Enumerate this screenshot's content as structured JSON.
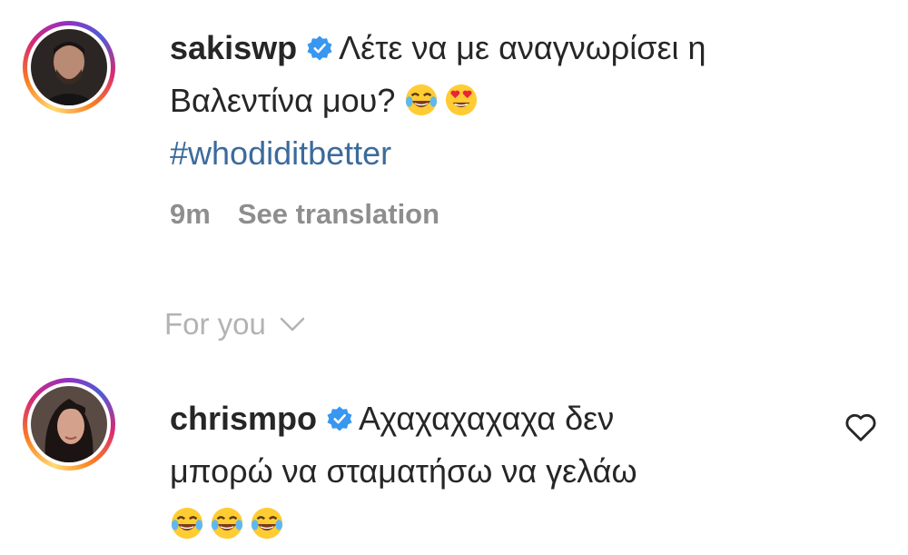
{
  "comments": [
    {
      "username": "sakiswp",
      "text_line1": "Λέτε να με αναγνωρίσει η",
      "text_line2": "Βαλεντίνα μου?",
      "hashtag": "#whodiditbetter",
      "time": "9m",
      "translate_label": "See translation",
      "emojis": [
        "tears-of-joy-emoji",
        "heart-eyes-emoji"
      ],
      "verified": true
    },
    {
      "username": "chrismpo",
      "text_line1": "Αχαχαχαχαχα δεν",
      "text_line2": "μπορώ να σταματήσω να γελάω",
      "emojis": [
        "tears-of-joy-emoji",
        "tears-of-joy-emoji",
        "tears-of-joy-emoji"
      ],
      "verified": true
    }
  ],
  "section": {
    "label": "For you"
  },
  "colors": {
    "text": "#262626",
    "muted": "#8e8e8e",
    "hashtag": "#3b6b9c",
    "verified": "#3897f0"
  }
}
